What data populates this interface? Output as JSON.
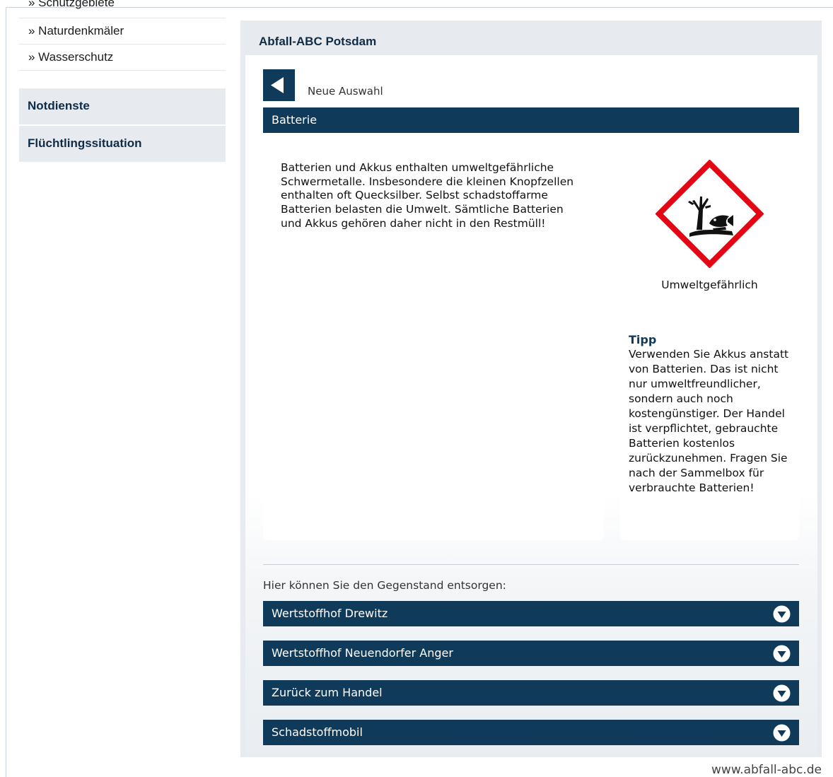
{
  "sidebar": {
    "cut_item": "» Schutzgebiete",
    "items": [
      {
        "label": "» Naturdenkmäler"
      },
      {
        "label": "» Wasserschutz"
      }
    ],
    "categories": [
      {
        "label": "Notdienste"
      },
      {
        "label": "Flüchtlingssituation"
      }
    ]
  },
  "panel": {
    "title": "Abfall-ABC Potsdam",
    "back_label": "Neue Auswahl",
    "item_name": "Batterie",
    "description": "Batterien und Akkus enthalten umweltgefährliche Schwermetalle. Insbesondere die kleinen Knopfzellen enthalten oft Quecksilber. Selbst schadstoffarme Batterien belasten die Umwelt. Sämtliche Batterien und Akkus gehören daher nicht in den Restmüll!",
    "hazard_label": "Umweltgefährlich",
    "hazard_icon": "environment-hazard-icon",
    "tip_title": "Tipp",
    "tip_text": "Verwenden Sie Akkus anstatt von Batterien. Das ist nicht nur umweltfreundlicher, sondern auch noch kostengünstiger. Der Handel ist verpflichtet, gebrauchte Batterien kostenlos zurückzunehmen. Fragen Sie nach der Sammelbox für verbrauchte Batterien!",
    "dispose_intro": "Hier können Sie den Gegenstand entsorgen:",
    "locations": [
      {
        "label": "Wertstoffhof Drewitz"
      },
      {
        "label": "Wertstoffhof Neuendorfer Anger"
      },
      {
        "label": "Zurück zum Handel"
      },
      {
        "label": "Schadstoffmobil"
      }
    ]
  },
  "footer": "www.abfall-abc.de",
  "colors": {
    "primary": "#0f3a5a",
    "panel_bg": "#e7ebef",
    "hazard_red": "#e30613"
  }
}
